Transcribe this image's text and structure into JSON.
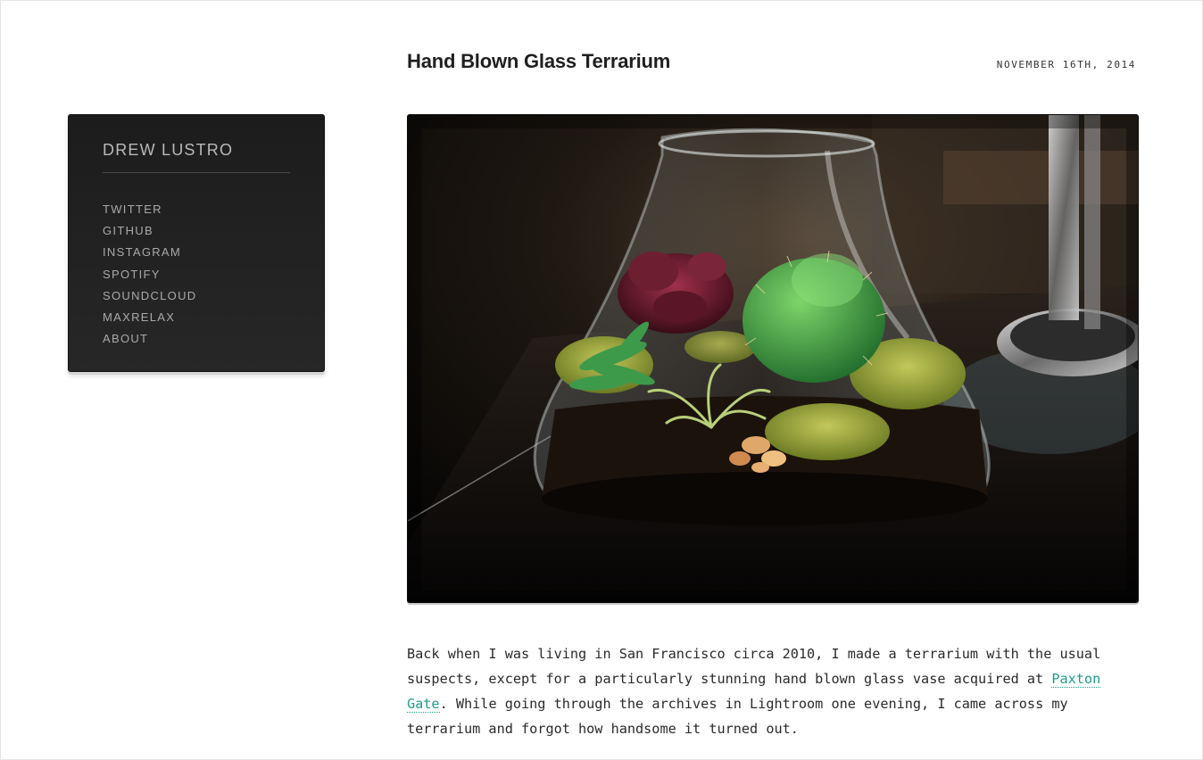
{
  "site": {
    "name": "DREW LUSTRO"
  },
  "nav": [
    {
      "label": "TWITTER"
    },
    {
      "label": "GITHUB"
    },
    {
      "label": "INSTAGRAM"
    },
    {
      "label": "SPOTIFY"
    },
    {
      "label": "SOUNDCLOUD"
    },
    {
      "label": "MAXRELAX"
    },
    {
      "label": "ABOUT"
    }
  ],
  "post": {
    "title": "Hand Blown Glass Terrarium",
    "date": "NOVEMBER 16TH, 2014",
    "body_before_link": "Back when I was living in San Francisco circa 2010, I made a terrarium with the usual suspects, except for a particularly stunning hand blown glass vase acquired at ",
    "link_text": "Paxton Gate",
    "body_after_link": ". While going through the archives in Lightroom one evening, I came across my terrarium and forgot how handsome it turned out."
  },
  "colors": {
    "sidebar_bg": "#222222",
    "link": "#1e9e8a",
    "title": "#1f1f1f"
  }
}
